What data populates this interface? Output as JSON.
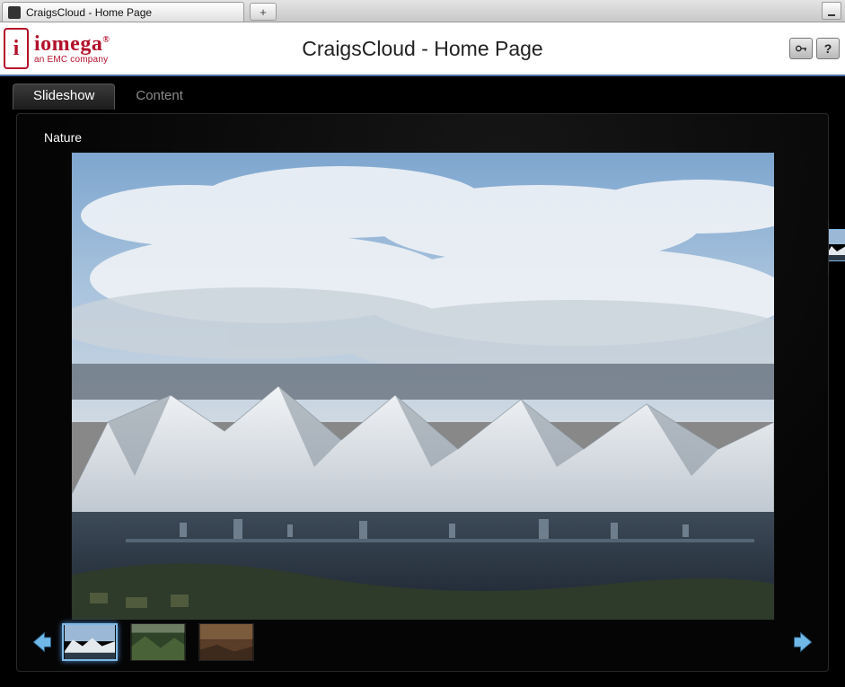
{
  "browser": {
    "tab_title": "CraigsCloud - Home Page",
    "newtab_glyph": "+"
  },
  "header": {
    "logo_brand": "iomega",
    "logo_reg": "®",
    "logo_subtitle": "an EMC company",
    "page_title": "CraigsCloud - Home Page",
    "key_button_name": "login-key-button",
    "help_button_name": "help-button",
    "help_glyph": "?"
  },
  "view_tabs": {
    "slideshow": "Slideshow",
    "content": "Content",
    "active": "slideshow"
  },
  "album": {
    "title": "Nature"
  },
  "slideshow": {
    "current_index": 0,
    "thumbnails": [
      {
        "name": "thumb-1",
        "palette": "mountain"
      },
      {
        "name": "thumb-2",
        "palette": "forest"
      },
      {
        "name": "thumb-3",
        "palette": "desert"
      }
    ]
  },
  "arrows": {
    "prev": "Previous",
    "next": "Next"
  }
}
